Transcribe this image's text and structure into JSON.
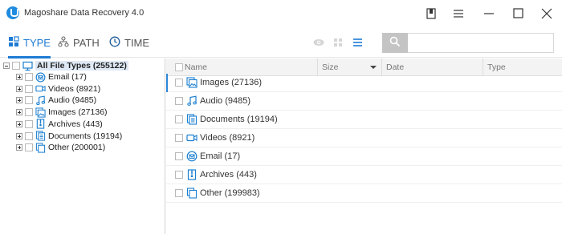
{
  "window": {
    "title": "Magoshare Data Recovery 4.0"
  },
  "toolbar": {
    "tabs": [
      {
        "label": "TYPE",
        "icon": "grid-icon",
        "active": true
      },
      {
        "label": "PATH",
        "icon": "hierarchy-icon",
        "active": false
      },
      {
        "label": "TIME",
        "icon": "clock-icon",
        "active": false
      }
    ],
    "search": {
      "placeholder": "",
      "value": ""
    }
  },
  "tree": {
    "root": {
      "label": "All File Types (255122)",
      "icon": "monitor-icon"
    },
    "items": [
      {
        "label": "Email (17)",
        "icon": "email-icon"
      },
      {
        "label": "Videos (8921)",
        "icon": "video-icon"
      },
      {
        "label": "Audio (9485)",
        "icon": "audio-icon"
      },
      {
        "label": "Images (27136)",
        "icon": "image-icon"
      },
      {
        "label": "Archives (443)",
        "icon": "archive-icon"
      },
      {
        "label": "Documents (19194)",
        "icon": "document-icon"
      },
      {
        "label": "Other (200001)",
        "icon": "other-icon"
      }
    ]
  },
  "list": {
    "columns": [
      "Name",
      "Size",
      "Date",
      "Type"
    ],
    "rows": [
      {
        "label": "Images (27136)",
        "icon": "image-icon"
      },
      {
        "label": "Audio (9485)",
        "icon": "audio-icon"
      },
      {
        "label": "Documents (19194)",
        "icon": "document-icon"
      },
      {
        "label": "Videos (8921)",
        "icon": "video-icon"
      },
      {
        "label": "Email (17)",
        "icon": "email-icon"
      },
      {
        "label": "Archives (443)",
        "icon": "archive-icon"
      },
      {
        "label": "Other (199983)",
        "icon": "other-icon"
      }
    ]
  },
  "colors": {
    "accent": "#1e7bd4",
    "icon_blue": "#1a7fd0"
  }
}
